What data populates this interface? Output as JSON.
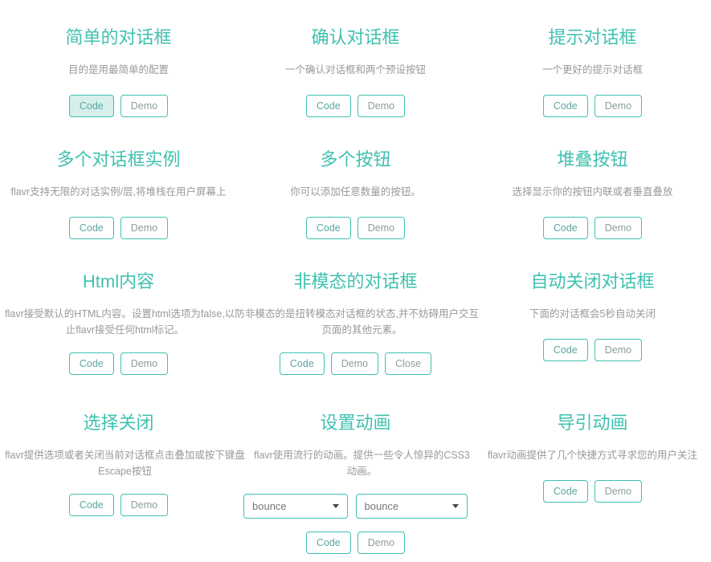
{
  "page": {
    "accent_color": "#3fc1b0",
    "title_color": "#3fc1b0",
    "desc_color": "#999999",
    "active_button_bg": "#d6efeb"
  },
  "labels": {
    "code": "Code",
    "demo": "Demo",
    "close": "Close"
  },
  "cards": [
    {
      "title": "简单的对话框",
      "desc": "目的是用最简单的配置",
      "buttons": [
        "Code",
        "Demo"
      ]
    },
    {
      "title": "确认对话框",
      "desc": "一个确认对话框和两个预设按钮",
      "buttons": [
        "Code",
        "Demo"
      ]
    },
    {
      "title": "提示对话框",
      "desc": "一个更好的提示对话框",
      "buttons": [
        "Code",
        "Demo"
      ]
    },
    {
      "title": "多个对话框实例",
      "desc": "flavr支持无限的对话实例/层,将堆栈在用户屏幕上",
      "buttons": [
        "Code",
        "Demo"
      ]
    },
    {
      "title": "多个按钮",
      "desc": "你可以添加任意数量的按钮。",
      "buttons": [
        "Code",
        "Demo"
      ]
    },
    {
      "title": "堆叠按钮",
      "desc": "选择显示你的按钮内联或者垂直叠放",
      "buttons": [
        "Code",
        "Demo"
      ]
    },
    {
      "title": "Html内容",
      "desc": "flavr接受默认的HTML内容。设置html选项为false,以防止flavr接受任何html标记。",
      "buttons": [
        "Code",
        "Demo"
      ]
    },
    {
      "title": "非模态的对话框",
      "desc": "非模态的是扭转模态对话框的状态,并不妨碍用户交互页面的其他元素。",
      "buttons": [
        "Code",
        "Demo",
        "Close"
      ]
    },
    {
      "title": "自动关闭对话框",
      "desc": "下面的对话框会5秒自动关闭",
      "buttons": [
        "Code",
        "Demo"
      ]
    },
    {
      "title": "选择关闭",
      "desc": "flavr提供选项或者关闭当前对话框点击叠加或按下键盘Escape按钮",
      "buttons": [
        "Code",
        "Demo"
      ]
    },
    {
      "title": "设置动画",
      "desc": "flavr使用流行的动画。提供一些令人惊异的CSS3动画。",
      "buttons": [
        "Code",
        "Demo"
      ],
      "selects": [
        {
          "value": "bounce"
        },
        {
          "value": "bounce"
        }
      ]
    },
    {
      "title": "导引动画",
      "desc": "flavr动画提供了几个快捷方式寻求您的用户关注",
      "buttons": [
        "Code",
        "Demo"
      ]
    }
  ]
}
